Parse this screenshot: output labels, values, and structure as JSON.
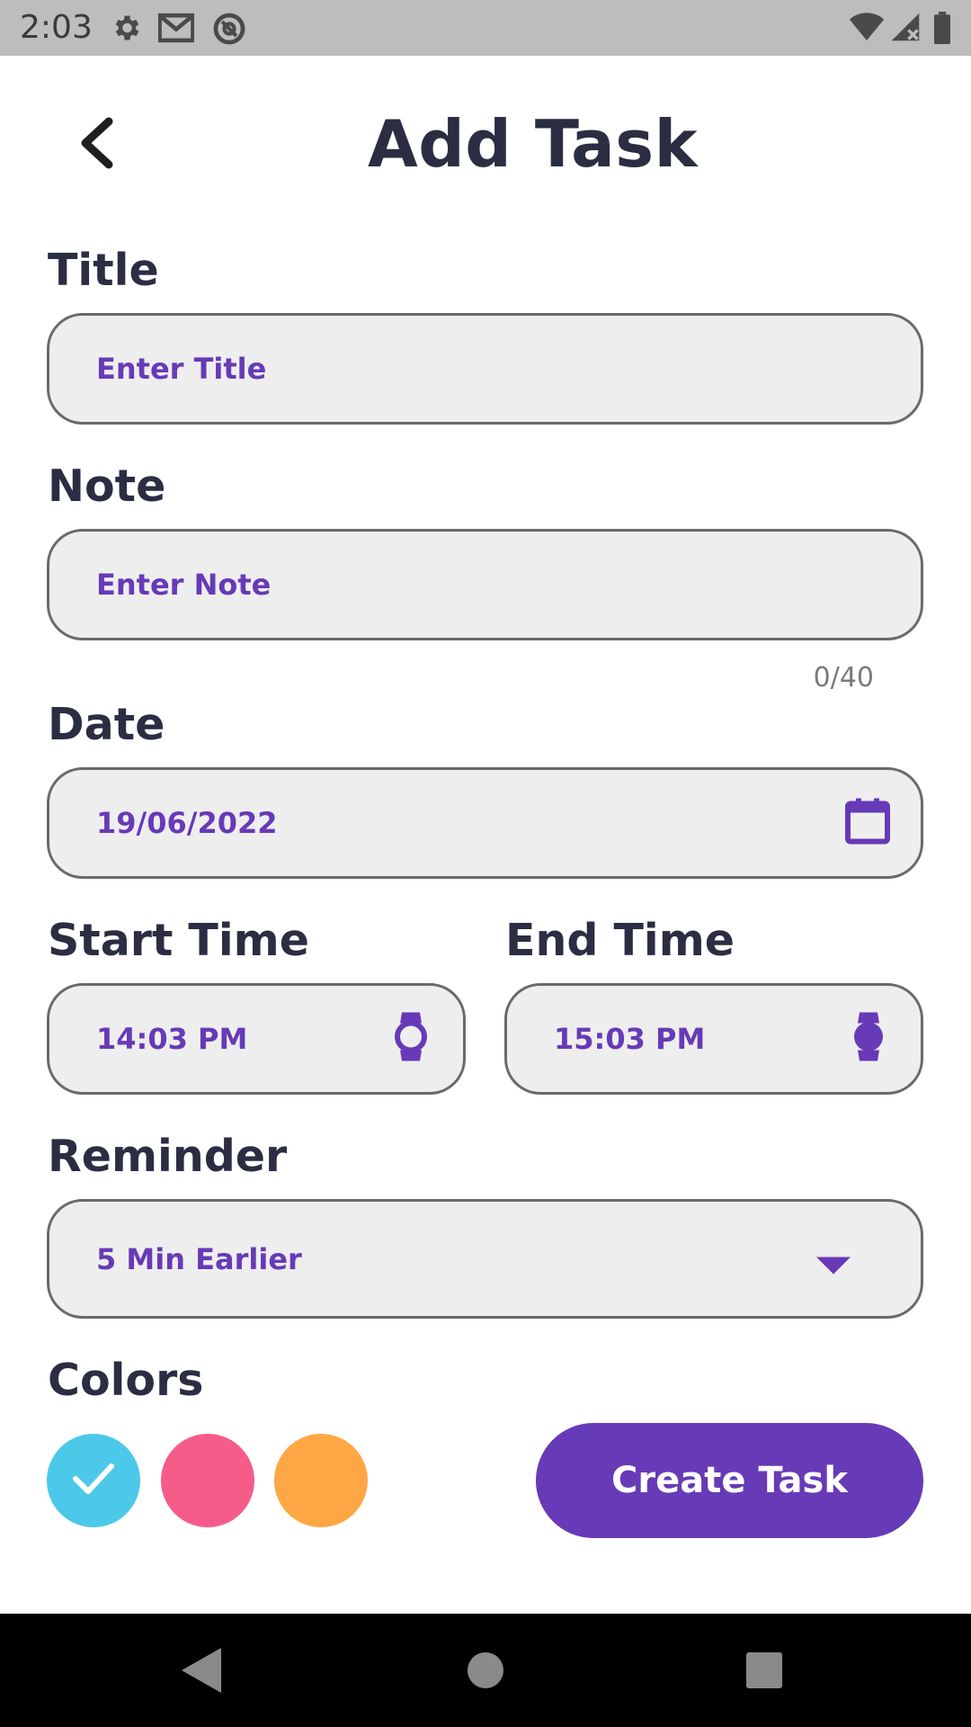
{
  "status_bar": {
    "time": "2:03",
    "icons": [
      "gear-icon",
      "gmail-icon",
      "at-sign-icon",
      "wifi-icon",
      "signal-icon",
      "battery-icon"
    ]
  },
  "header": {
    "title": "Add Task",
    "back_icon": "chevron-left-icon"
  },
  "form": {
    "title": {
      "label": "Title",
      "placeholder": "Enter Title"
    },
    "note": {
      "label": "Note",
      "placeholder": "Enter Note",
      "counter": "0/40"
    },
    "date": {
      "label": "Date",
      "value": "19/06/2022",
      "icon": "calendar-icon"
    },
    "start_time": {
      "label": "Start Time",
      "value": "14:03 PM",
      "icon": "watch-icon"
    },
    "end_time": {
      "label": "End Time",
      "value": "15:03 PM",
      "icon": "watch-icon"
    },
    "reminder": {
      "label": "Reminder",
      "value": "5 Min Earlier",
      "icon": "dropdown-arrow-icon"
    },
    "colors": {
      "label": "Colors",
      "options": [
        "#4cc9e8",
        "#f65c8a",
        "#ffa744"
      ],
      "selected_index": 0
    }
  },
  "actions": {
    "create_label": "Create Task"
  },
  "theme": {
    "accent": "#673ab7",
    "text": "#2b2d42",
    "field_bg": "#eeeeee"
  },
  "nav_bar": {
    "icons": [
      "back-triangle-icon",
      "home-circle-icon",
      "recents-square-icon"
    ]
  }
}
